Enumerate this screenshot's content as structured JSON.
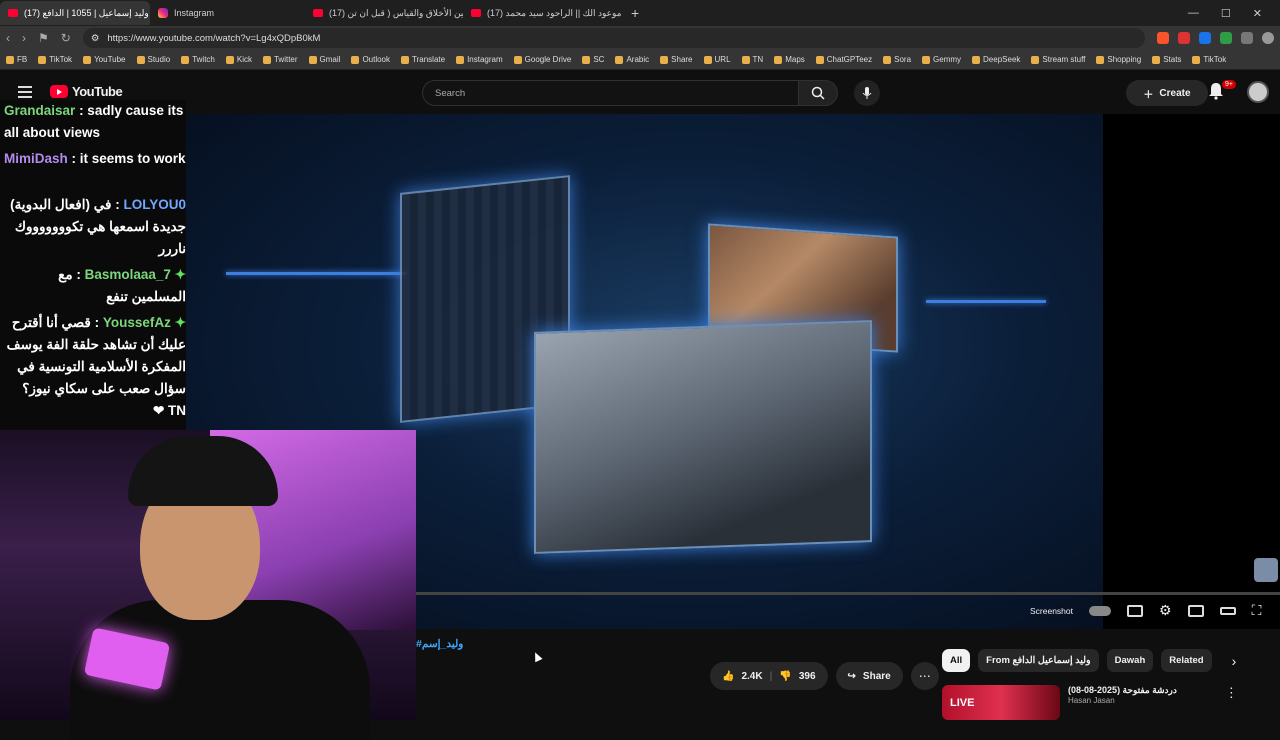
{
  "browser": {
    "tabs": [
      {
        "label": "(17) وليد إسماعيل | 1055 | الدافع",
        "active": true
      },
      {
        "label": "Instagram",
        "active": false
      },
      {
        "label": "(17) الله بين الأخلاق والقياس ( قبل ان تن",
        "active": false
      },
      {
        "label": "(17) موعود الك || الراحود سيد محمد",
        "active": false
      }
    ],
    "url": "https://www.youtube.com/watch?v=Lg4xQDpB0kM",
    "bookmarks": [
      "FB",
      "TikTok",
      "YouTube",
      "Studio",
      "Twitch",
      "Kick",
      "Twitter",
      "Gmail",
      "Outlook",
      "Translate",
      "Instagram",
      "Google Drive",
      "SC",
      "Arabic",
      "Share",
      "URL",
      "TN",
      "Maps",
      "ChatGPTeez",
      "Sora",
      "Gemmy",
      "DeepSeek",
      "Stream stuff",
      "Shopping",
      "Stats",
      "TikTok"
    ]
  },
  "youtube": {
    "logo": "YouTube",
    "search_placeholder": "Search",
    "create_label": "Create",
    "notif_count": "9+"
  },
  "chat": [
    {
      "user": "Grandaisar",
      "text": ": sadly cause its all about views",
      "color": "#7dd67d",
      "rtl": false
    },
    {
      "user": "MimiDash",
      "text": ": it seems to work",
      "color": "#b38cf0",
      "rtl": false
    },
    {
      "user": "LOLYOU0",
      "text": ": في (افعال البدوية) جديدة اسمعها هي تكوووووووك ناررر",
      "color": "#6fa8ff",
      "rtl": true
    },
    {
      "user": "Basmolaaa_7",
      "text": ": مع المسلمين تنفع",
      "color": "#7dd67d",
      "rtl": true
    },
    {
      "user": "YoussefAz",
      "text": ": قصي أنا أقترح عليك أن تشاهد حلقة الفة يوسف المفكرة الأسلامية التونسية في سؤال صعب على سكاي نيوز؟ TN ❤",
      "color": "#7dd67d",
      "rtl": true
    }
  ],
  "player": {
    "screenshot_label": "Screenshot"
  },
  "video_info": {
    "hashtag": "#وليد_إسم",
    "likes": "2.4K",
    "dislikes": "396",
    "share_label": "Share"
  },
  "filters": [
    "All",
    "From وليد إسماعيل الدافع",
    "Dawah",
    "Related"
  ],
  "recommendation": {
    "thumb_text": "LIVE",
    "title": "دردشة مفتوحة (2025-08-08)",
    "channel": "Hasan Jasan"
  }
}
